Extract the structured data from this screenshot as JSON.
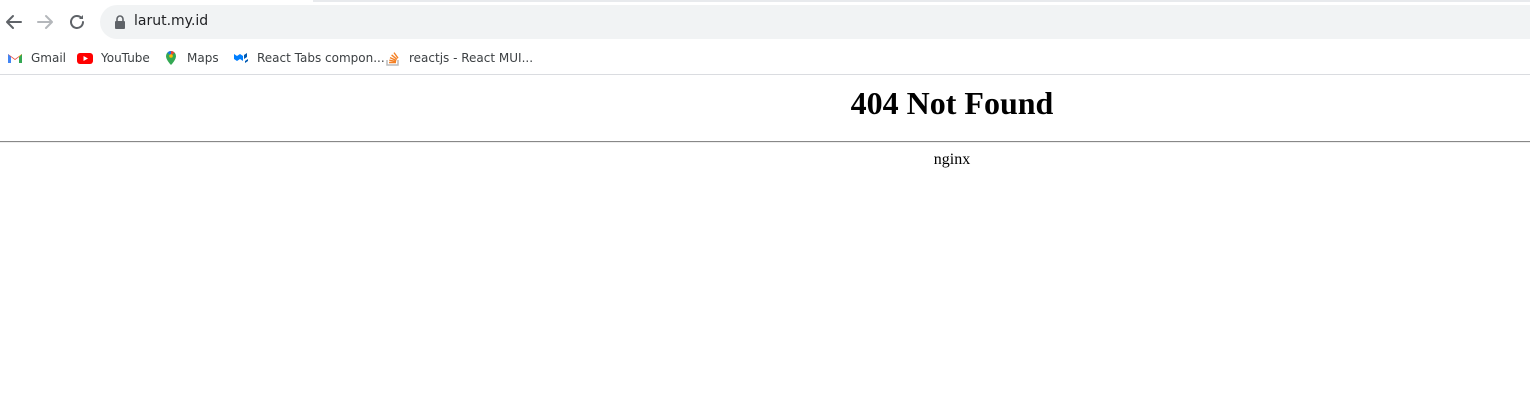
{
  "browser": {
    "url": "larut.my.id",
    "nav": {
      "back_icon": "arrow-left-icon",
      "forward_icon": "arrow-right-icon",
      "reload_icon": "reload-icon"
    },
    "bookmarks": [
      {
        "label": "Gmail",
        "icon": "gmail-icon"
      },
      {
        "label": "YouTube",
        "icon": "youtube-icon"
      },
      {
        "label": "Maps",
        "icon": "maps-icon"
      },
      {
        "label": "React Tabs compon...",
        "icon": "mui-icon"
      },
      {
        "label": "reactjs - React MUI...",
        "icon": "stackoverflow-icon"
      }
    ]
  },
  "page": {
    "heading": "404 Not Found",
    "server": "nginx"
  },
  "colors": {
    "omnibox_bg": "#f1f3f4",
    "rule": "#888888"
  }
}
